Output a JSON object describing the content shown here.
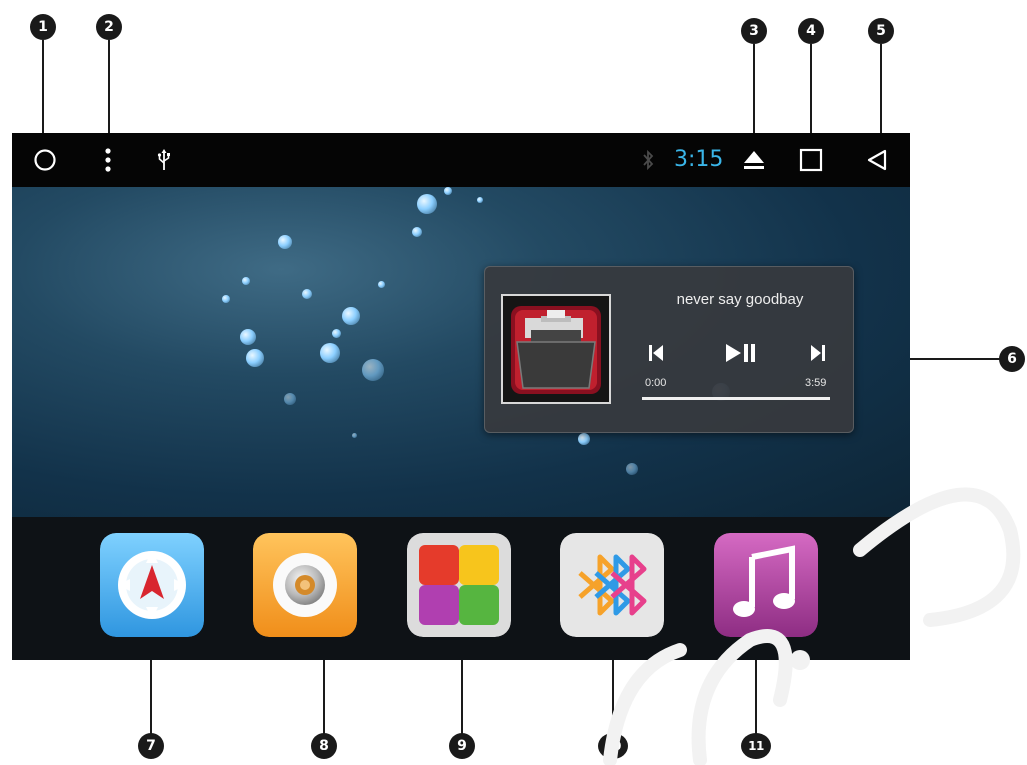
{
  "callouts": [
    "1",
    "2",
    "3",
    "4",
    "5",
    "6",
    "7",
    "8",
    "9",
    "10",
    "11"
  ],
  "status_bar": {
    "home_icon": "circle-icon",
    "menu_icon": "vertical-dots-icon",
    "usb_icon": "usb-icon",
    "bluetooth_icon": "bluetooth-icon",
    "time": "3:15",
    "eject_icon": "eject-icon",
    "recent_apps_icon": "square-icon",
    "back_icon": "triangle-back-icon",
    "clock_color": "#3ab5e8"
  },
  "music_widget": {
    "song_title": "never say goodbay",
    "elapsed": "0:00",
    "duration": "3:59",
    "progress": 0.0,
    "controls": [
      "previous-icon",
      "play-pause-icon",
      "next-icon"
    ]
  },
  "dock": {
    "apps": [
      {
        "icon": "navigation-compass-icon",
        "color": "#4cb3ef"
      },
      {
        "icon": "radio-icon",
        "color": "#f3a436"
      },
      {
        "icon": "app-grid-icon",
        "color": "#dcdcdc"
      },
      {
        "icon": "bluetooth-app-icon",
        "color": "#e6e6e6"
      },
      {
        "icon": "music-note-icon",
        "color": "#b2499e"
      }
    ]
  }
}
